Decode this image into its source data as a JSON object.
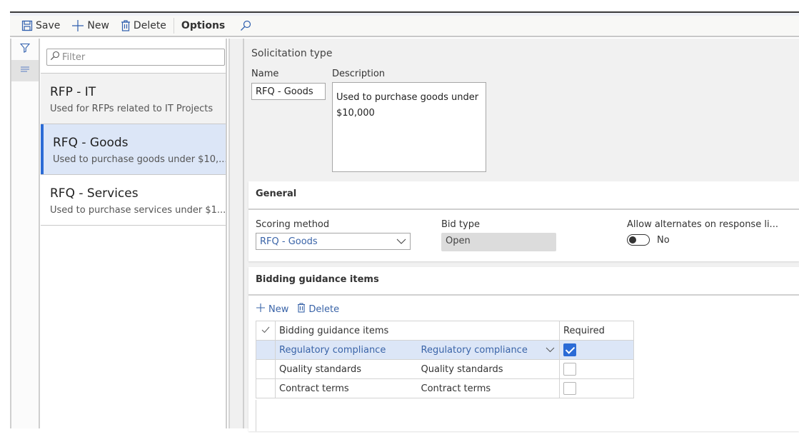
{
  "toolbar": {
    "save_label": "Save",
    "new_label": "New",
    "delete_label": "Delete",
    "options_label": "Options",
    "icons": {
      "save": "save-icon",
      "new": "plus-icon",
      "delete": "trash-icon",
      "search": "search-icon"
    }
  },
  "nav_rail": {
    "icons": [
      "filter-icon",
      "list-icon"
    ]
  },
  "list_pane": {
    "filter_placeholder": "Filter",
    "items": [
      {
        "title": "RFP - IT",
        "description": "Used for RFPs related to IT Projects"
      },
      {
        "title": "RFQ - Goods",
        "description": "Used to purchase goods under $10,...",
        "selected": true
      },
      {
        "title": "RFQ - Services",
        "description": "Used to purchase services under $1..."
      }
    ]
  },
  "detail": {
    "section_title": "Solicitation type",
    "name_label": "Name",
    "name_value": "RFQ - Goods",
    "description_label": "Description",
    "description_value": "Used to purchase goods under $10,000"
  },
  "general": {
    "header": "General",
    "scoring_method_label": "Scoring method",
    "scoring_method_value": "RFQ - Goods",
    "bid_type_label": "Bid type",
    "bid_type_value": "Open",
    "allow_alternates_label": "Allow alternates on response li...",
    "allow_alternates_value": "No",
    "allow_alternates_on": false
  },
  "bidding": {
    "header": "Bidding guidance items",
    "new_label": "New",
    "delete_label": "Delete",
    "columns": [
      "Bidding guidance items",
      "Required"
    ],
    "rows": [
      {
        "name": "Regulatory compliance",
        "description": "Regulatory compliance",
        "required": true,
        "selected": true
      },
      {
        "name": "Quality standards",
        "description": "Quality standards",
        "required": false,
        "selected": false
      },
      {
        "name": "Contract terms",
        "description": "Contract terms",
        "required": false,
        "selected": false
      }
    ]
  },
  "colors": {
    "accent": "#2b6bd6",
    "link": "#3a64a8",
    "selection": "#dce6f7",
    "content_bg": "#f1f1f1"
  }
}
